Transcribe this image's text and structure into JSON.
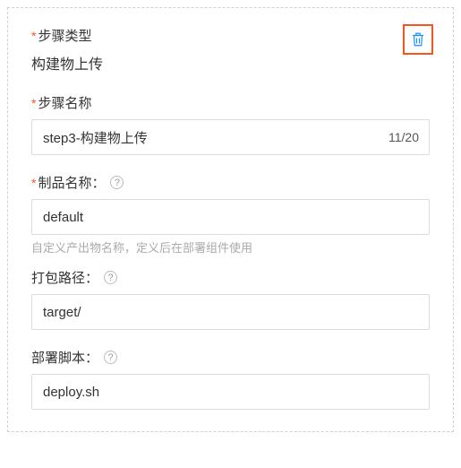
{
  "step_type": {
    "label": "步骤类型",
    "value": "构建物上传"
  },
  "step_name": {
    "label": "步骤名称",
    "value": "step3-构建物上传",
    "counter": "11/20"
  },
  "artifact_name": {
    "label": "制品名称：",
    "value": "default",
    "hint": "自定义产出物名称，定义后在部署组件使用"
  },
  "pack_path": {
    "label": "打包路径：",
    "value": "target/"
  },
  "deploy_script": {
    "label": "部署脚本：",
    "value": "deploy.sh"
  },
  "required_mark": "*",
  "help_glyph": "?"
}
